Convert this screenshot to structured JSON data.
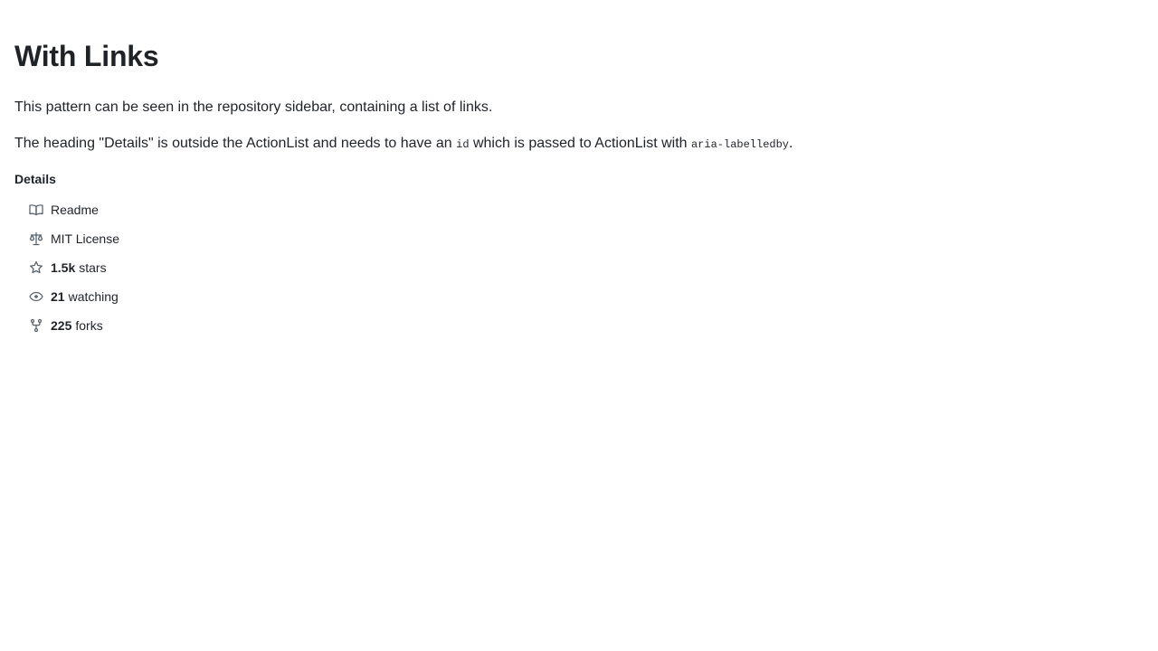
{
  "page": {
    "title": "With Links",
    "description1": "This pattern can be seen in the repository sidebar, containing a list of links.",
    "description2_before": "The heading \"Details\" is outside the ActionList and needs to have an ",
    "description2_code1": "id",
    "description2_middle": " which is passed to ActionList with ",
    "description2_code2": "aria-labelledby",
    "description2_after": "."
  },
  "details": {
    "heading": "Details",
    "items": [
      {
        "icon": "book-icon",
        "count": "",
        "label": "Readme"
      },
      {
        "icon": "law-icon",
        "count": "",
        "label": "MIT License"
      },
      {
        "icon": "star-icon",
        "count": "1.5k",
        "label": "stars"
      },
      {
        "icon": "eye-icon",
        "count": "21",
        "label": "watching"
      },
      {
        "icon": "repo-forked-icon",
        "count": "225",
        "label": "forks"
      }
    ]
  },
  "colors": {
    "text": "#1f2328",
    "icon": "#59636e"
  }
}
